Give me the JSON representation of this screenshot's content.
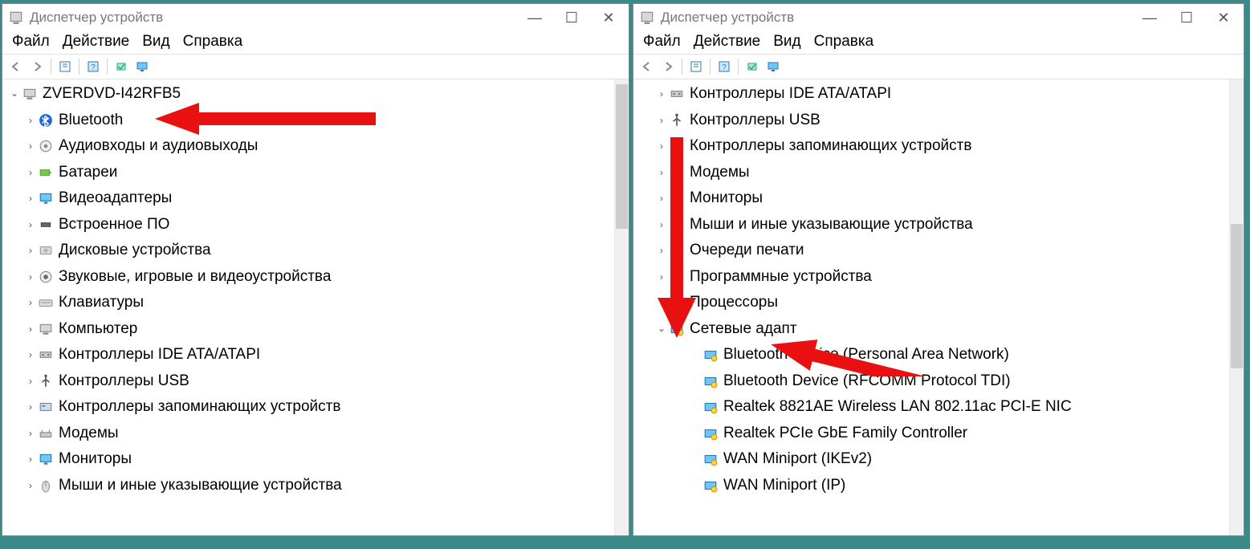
{
  "window_title": "Диспетчер устройств",
  "window_controls": {
    "min": "—",
    "max": "☐",
    "close": "✕"
  },
  "menus": [
    "Файл",
    "Действие",
    "Вид",
    "Справка"
  ],
  "left": {
    "root": "ZVERDVD-I42RFB5",
    "items": [
      {
        "label": "Bluetooth",
        "icon": "bt"
      },
      {
        "label": "Аудиовходы и аудиовыходы",
        "icon": "audio"
      },
      {
        "label": "Батареи",
        "icon": "battery"
      },
      {
        "label": "Видеоадаптеры",
        "icon": "display"
      },
      {
        "label": "Встроенное ПО",
        "icon": "chip"
      },
      {
        "label": "Дисковые устройства",
        "icon": "disk"
      },
      {
        "label": "Звуковые, игровые и видеоустройства",
        "icon": "sound"
      },
      {
        "label": "Клавиатуры",
        "icon": "kbd"
      },
      {
        "label": "Компьютер",
        "icon": "pc"
      },
      {
        "label": "Контроллеры IDE ATA/ATAPI",
        "icon": "ide"
      },
      {
        "label": "Контроллеры USB",
        "icon": "usb"
      },
      {
        "label": "Контроллеры запоминающих устройств",
        "icon": "storage"
      },
      {
        "label": "Модемы",
        "icon": "modem"
      },
      {
        "label": "Мониторы",
        "icon": "monitor"
      },
      {
        "label": "Мыши и иные указывающие устройства",
        "icon": "mouse"
      }
    ]
  },
  "right": {
    "top_items": [
      {
        "label": "Контроллеры IDE ATA/ATAPI",
        "icon": "ide"
      },
      {
        "label": "Контроллеры USB",
        "icon": "usb"
      },
      {
        "label": "Контроллеры запоминающих устройств",
        "icon": "storage"
      },
      {
        "label": "Модемы",
        "icon": "modem"
      },
      {
        "label": "Мониторы",
        "icon": "monitor"
      },
      {
        "label": "Мыши и иные указывающие устройства",
        "icon": "mouse"
      },
      {
        "label": "Очереди печати",
        "icon": "print"
      },
      {
        "label": "Программные устройства",
        "icon": "soft"
      },
      {
        "label": "Процессоры",
        "icon": "cpu"
      }
    ],
    "expanded_label": "Сетевые адапт",
    "children": [
      "Bluetooth Device (Personal Area Network)",
      "Bluetooth Device (RFCOMM Protocol TDI)",
      "Realtek 8821AE Wireless LAN 802.11ac PCI-E NIC",
      "Realtek PCIe GbE Family Controller",
      "WAN Miniport (IKEv2)",
      "WAN Miniport (IP)"
    ]
  }
}
